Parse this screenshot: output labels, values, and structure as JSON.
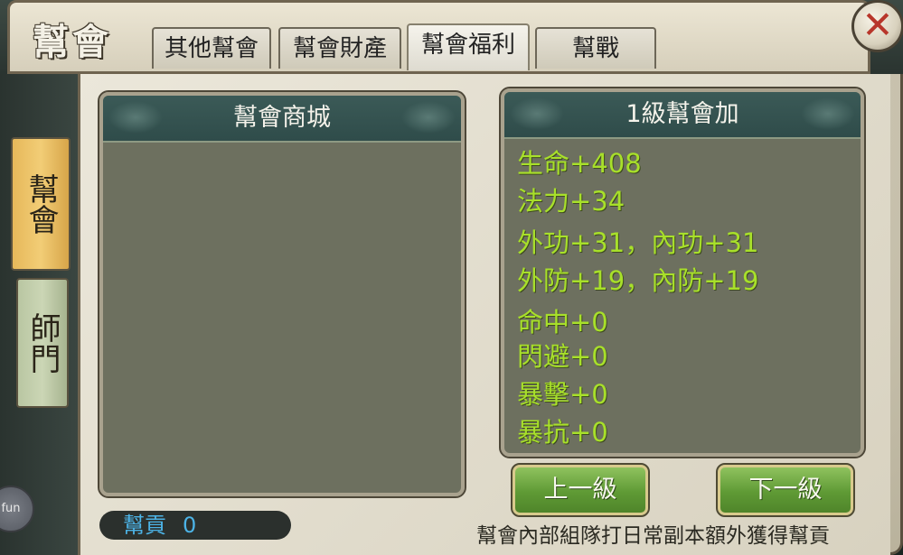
{
  "header": {
    "title": "幫會",
    "tabs": [
      {
        "label": "其他幫會",
        "active": false
      },
      {
        "label": "幫會財產",
        "active": false
      },
      {
        "label": "幫會福利",
        "active": true
      },
      {
        "label": "幫戰",
        "active": false
      }
    ],
    "close_icon": "close-icon"
  },
  "sidebar": {
    "items": [
      {
        "label": "幫會",
        "active": true
      },
      {
        "label": "師門",
        "active": false
      }
    ]
  },
  "shop_panel": {
    "title": "幫會商城"
  },
  "bonus_panel": {
    "title": "1級幫會加",
    "lines": [
      "生命+408",
      "法力+34",
      "外功+31，內功+31",
      "外防+19，內防+19",
      "命中+0",
      "閃避+0",
      "暴擊+0",
      "暴抗+0"
    ],
    "text_color": "#a8e02a"
  },
  "buttons": {
    "prev_level": "上一級",
    "next_level": "下一級"
  },
  "contribution": {
    "label": "幫貢",
    "value": "0",
    "color": "#4cb3e6"
  },
  "hint": "幫會內部組隊打日常副本額外獲得幫貢",
  "floating_button": "fun"
}
